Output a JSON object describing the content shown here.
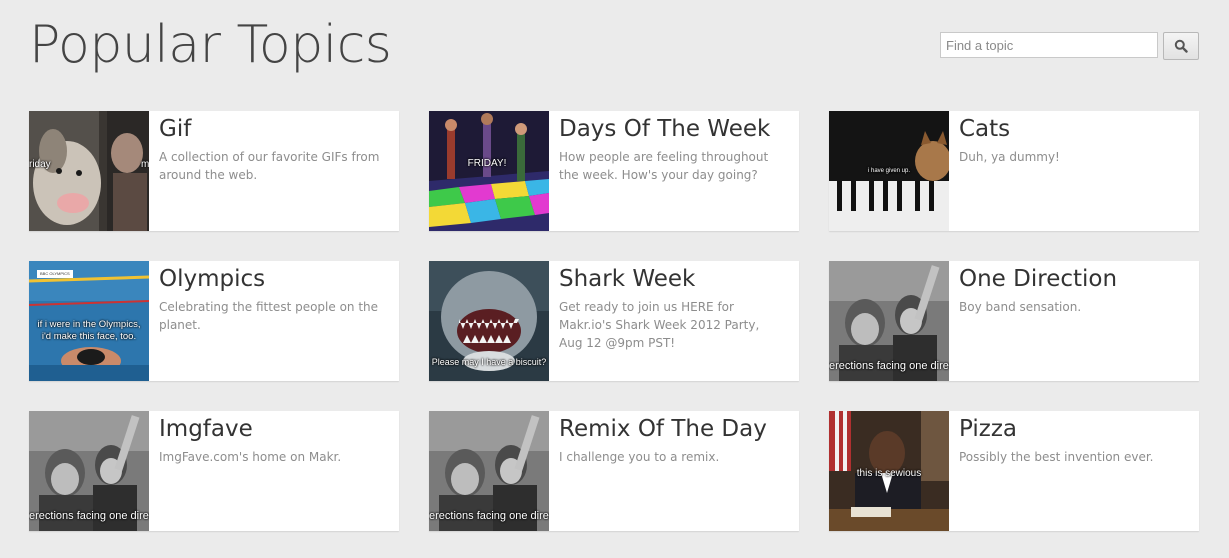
{
  "page": {
    "title": "Popular Topics"
  },
  "search": {
    "placeholder": "Find a topic",
    "button_icon": "search-icon"
  },
  "topics": [
    {
      "title": "Gif",
      "description": "A collection of our favorite GIFs from around the web.",
      "caption_left": "riday",
      "caption_right": "m"
    },
    {
      "title": "Days Of The Week",
      "description": "How people are feeling throughout the week. How's your day going?",
      "caption": "FRIDAY!"
    },
    {
      "title": "Cats",
      "description": "Duh, ya dummy!",
      "caption": "i have given up."
    },
    {
      "title": "Olympics",
      "description": "Celebrating the fittest people on the planet.",
      "caption_tag": "BBC OLYMPICS",
      "caption_line1": "if i were in the Olympics,",
      "caption_line2": "i'd make this face, too."
    },
    {
      "title": "Shark Week",
      "description": "Get ready to join us HERE for Makr.io's Shark Week 2012 Party, Aug 12 @9pm PST!",
      "caption": "Please may I have a biscuit?"
    },
    {
      "title": "One Direction",
      "description": "Boy band sensation.",
      "caption": "erections facing one direc"
    },
    {
      "title": "Imgfave",
      "description": "ImgFave.com's home on Makr.",
      "caption": "erections facing one direc"
    },
    {
      "title": "Remix Of The Day",
      "description": "I challenge you to a remix.",
      "caption": "erections facing one direc"
    },
    {
      "title": "Pizza",
      "description": "Possibly the best invention ever.",
      "caption": "this is sewious"
    }
  ]
}
